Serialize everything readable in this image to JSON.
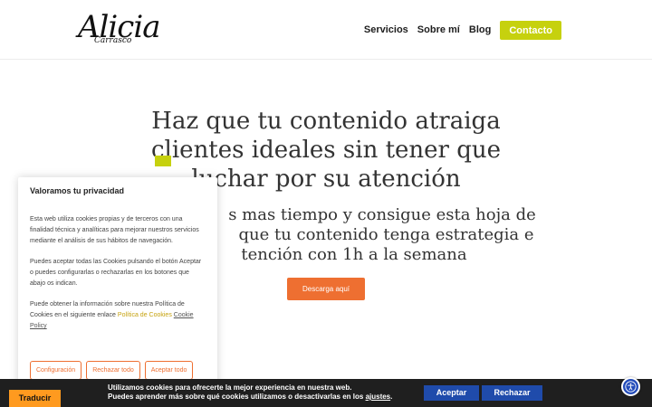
{
  "header": {
    "logo": {
      "main": "Alicia",
      "sub": "Carrasco"
    },
    "nav": [
      {
        "label": "Servicios"
      },
      {
        "label": "Sobre mí"
      },
      {
        "label": "Blog"
      }
    ],
    "cta_label": "Contacto",
    "accent_color": "#c6d10e"
  },
  "hero": {
    "title_lines": [
      "Haz que tu contenido atraiga",
      "clientes ideales sin tener que",
      "luchar por su atención"
    ],
    "subtitle_lines": [
      "s mas tiempo y consigue esta hoja de",
      "que tu contenido tenga estrategia e",
      "tención con 1h a la semana"
    ],
    "download_label": "Descarga aquí",
    "button_color": "#ee6f31"
  },
  "cookie_modal": {
    "title": "Valoramos tu privacidad",
    "p1": "Esta web utiliza cookies propias y de terceros con una finalidad técnica y analíticas para mejorar nuestros servicios mediante el análisis de sus hábitos de navegación.",
    "p2": "Puedes aceptar todas las Cookies pulsando el botón Aceptar o puedes configurarlas o rechazarlas en los botones que abajo os indican.",
    "p3_prefix": "Puede obtener la información sobre nuestra Política de Cookies en el siguiente enlace ",
    "p3_link": "Política de Cookies",
    "p3_link2": "Cookie Policy",
    "buttons": {
      "config": "Configuración",
      "reject": "Rechazar todo",
      "accept": "Aceptar todo"
    }
  },
  "bottom_bar": {
    "translate_label": "Traducir",
    "line1": "Utilizamos cookies para ofrecerte la mejor experiencia en nuestra web.",
    "line2_prefix": "Puedes aprender más sobre qué cookies utilizamos o desactivarlas en los ",
    "line2_link": "ajustes",
    "line2_suffix": ".",
    "accept_label": "Aceptar",
    "reject_label": "Rechazar"
  },
  "accessibility": {
    "icon": "accessibility-icon"
  }
}
